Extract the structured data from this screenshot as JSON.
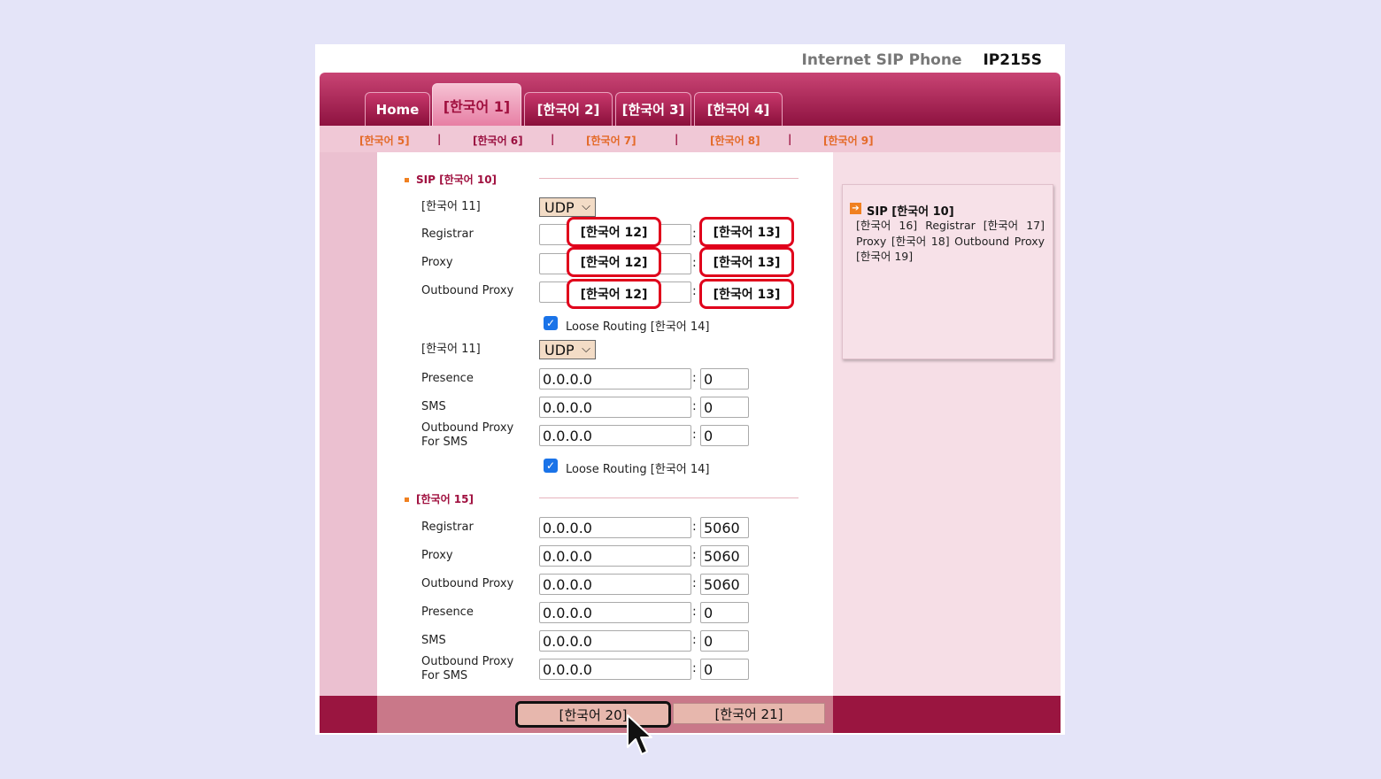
{
  "brand": {
    "product": "Internet SIP Phone",
    "model": "IP215S"
  },
  "tabs": [
    {
      "label": "Home",
      "active": false
    },
    {
      "label": "[한국어 1]",
      "active": true
    },
    {
      "label": "[한국어 2]",
      "active": false
    },
    {
      "label": "[한국어 3]",
      "active": false
    },
    {
      "label": "[한국어 4]",
      "active": false
    }
  ],
  "subnav": {
    "items": [
      "[한국어 5]",
      "[한국어 6]",
      "[한국어 7]",
      "[한국어 8]",
      "[한국어 9]"
    ],
    "active": "[한국어 6]",
    "separator": "|"
  },
  "sip": {
    "title": "SIP [한국어 10]",
    "conn_label": "[한국어 11]",
    "conn_value": "UDP",
    "registrar_label": "Registrar",
    "proxy_label": "Proxy",
    "outbound_label": "Outbound Proxy",
    "callout_addr": "[한국어 12]",
    "callout_port": "[한국어 13]",
    "loose_routing": "Loose Routing [한국어 14]",
    "conn2_label": "[한국어 11]",
    "conn2_value": "UDP",
    "presence_label": "Presence",
    "presence_addr": "0.0.0.0",
    "presence_port": "0",
    "sms_label": "SMS",
    "sms_addr": "0.0.0.0",
    "sms_port": "0",
    "obsms_label_1": "Outbound Proxy",
    "obsms_label_2": "For SMS",
    "obsms_addr": "0.0.0.0",
    "obsms_port": "0",
    "loose_routing_2": "Loose Routing [한국어 14]"
  },
  "backup": {
    "title": "[한국어 15]",
    "registrar_label": "Registrar",
    "registrar_addr": "0.0.0.0",
    "registrar_port": "5060",
    "proxy_label": "Proxy",
    "proxy_addr": "0.0.0.0",
    "proxy_port": "5060",
    "outbound_label": "Outbound Proxy",
    "outbound_addr": "0.0.0.0",
    "outbound_port": "5060",
    "presence_label": "Presence",
    "presence_addr": "0.0.0.0",
    "presence_port": "0",
    "sms_label": "SMS",
    "sms_addr": "0.0.0.0",
    "sms_port": "0",
    "obsms_label_1": "Outbound Proxy",
    "obsms_label_2": "For SMS",
    "obsms_addr": "0.0.0.0",
    "obsms_port": "0"
  },
  "help": {
    "title": "SIP [한국어 10]",
    "text": "[한국어 16] Registrar [한국어 17] Proxy [한국어 18] Outbound Proxy [한국어 19]"
  },
  "buttons": {
    "save": "[한국어 20]",
    "cancel": "[한국어 21]"
  },
  "colors": {
    "accent": "#a0103f",
    "tab_band": "#b82a5c",
    "highlight": "#e0001b"
  }
}
